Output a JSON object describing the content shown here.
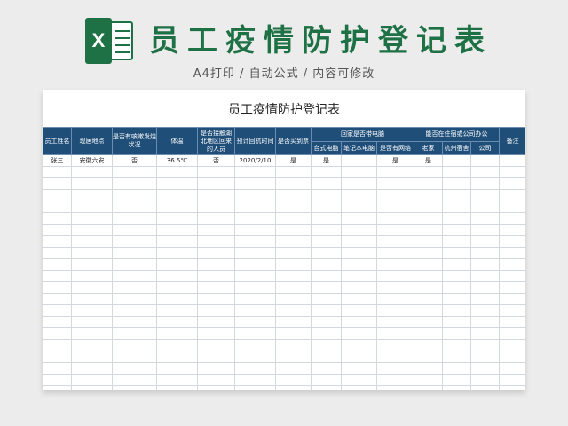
{
  "header": {
    "title": "员工疫情防护登记表",
    "subtitle": "A4打印 / 自动公式 / 内容可修改",
    "logo_letter": "X"
  },
  "sheet": {
    "title": "员工疫情防护登记表",
    "columns": {
      "name": "员工姓名",
      "location": "现居地点",
      "cough": "是否有咳嗽发烧状况",
      "temp": "体温",
      "hubei": "是否接触湖北地区回来的人员",
      "return_time": "预计回杭时间",
      "ticket": "是否买到票",
      "computer_group": "回家是否带电脑",
      "desktop": "台式电脑",
      "laptop": "笔记本电脑",
      "network": "是否有网络",
      "office_group": "能否在住宿或公司办公",
      "home": "老家",
      "dorm": "杭州宿舍",
      "company": "公司",
      "remark": "备注"
    },
    "rows": [
      [
        "张三",
        "安徽六安",
        "否",
        "36.5℃",
        "否",
        "2020/2/10",
        "是",
        "是",
        "",
        "是",
        "是",
        "",
        "",
        ""
      ]
    ],
    "empty_rows": 22
  },
  "colors": {
    "brand_green": "#1e7145",
    "header_blue": "#1f4e79"
  }
}
